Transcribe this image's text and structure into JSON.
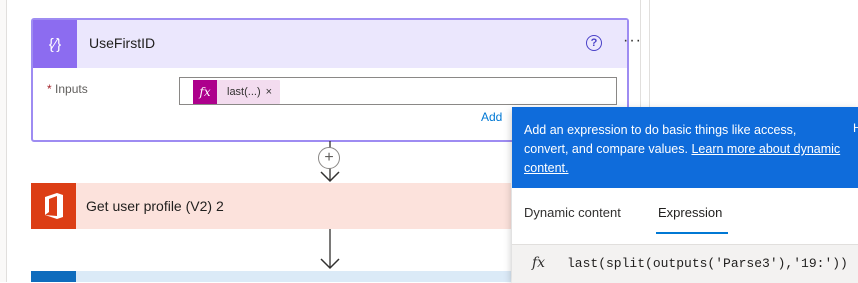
{
  "compose_card": {
    "icon": "compose-braces-icon",
    "icon_glyph": "{⁄}",
    "title": "UseFirstID",
    "help_glyph": "?",
    "more_glyph": "···",
    "inputs_required_mark": "*",
    "inputs_label": "Inputs",
    "token": {
      "icon_glyph": "fx",
      "text": "last(...)",
      "remove_glyph": "×"
    },
    "add_link": "Add"
  },
  "connector": {
    "plus_glyph": "+"
  },
  "office_card": {
    "icon": "office-logo-icon",
    "title": "Get user profile (V2) 2"
  },
  "expression_popup": {
    "description_prefix": "Add an expression to do basic things like access, convert, and compare values.",
    "learn_more_link": "Learn more about dynamic content.",
    "cut_off_char": "H",
    "tabs": [
      {
        "label": "Dynamic content",
        "selected": false
      },
      {
        "label": "Expression",
        "selected": true
      }
    ],
    "expression_fx": "fx",
    "expression_value": "last(split(outputs('Parse3'),'19:'))"
  },
  "colors": {
    "compose_accent": "#8c6cf0",
    "compose_border": "#9e8cf2",
    "office_accent": "#dc3e15",
    "popup_blue": "#0f6cdb",
    "token_pink": "#ad008c"
  }
}
